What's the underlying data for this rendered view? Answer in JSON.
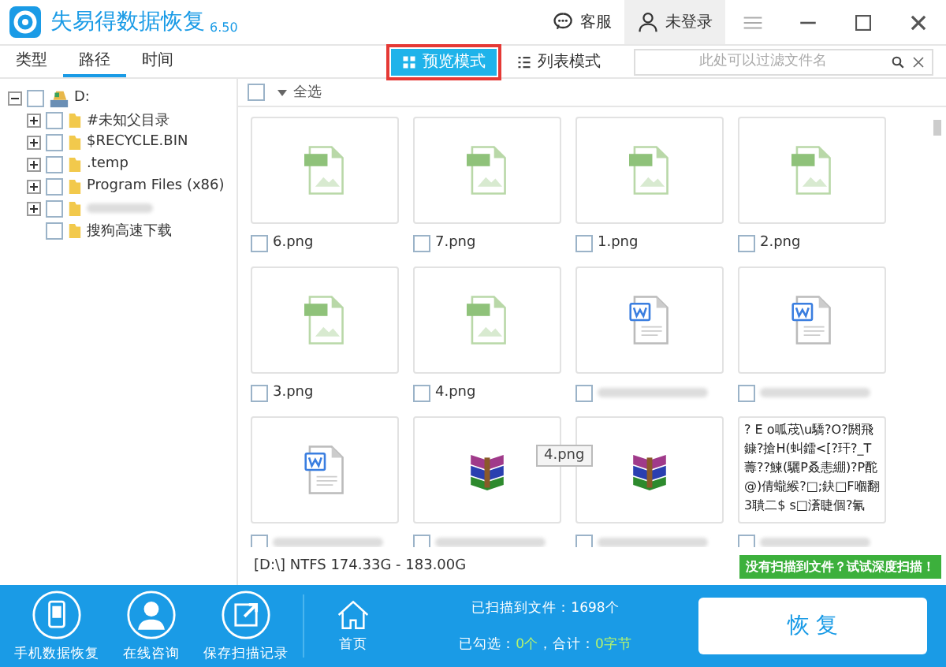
{
  "app": {
    "title": "失易得数据恢复",
    "version": "6.50"
  },
  "header": {
    "service": "客服",
    "user": "未登录"
  },
  "tabs": [
    {
      "label": "类型",
      "selected": false
    },
    {
      "label": "路径",
      "selected": true
    },
    {
      "label": "时间",
      "selected": false
    }
  ],
  "view_modes": [
    {
      "label": "预览模式",
      "kind": "grid",
      "selected": true
    },
    {
      "label": "列表模式",
      "kind": "list",
      "selected": false
    }
  ],
  "search": {
    "placeholder": "此处可以过滤文件名"
  },
  "tree": {
    "label": "D:",
    "checked": false,
    "expanded": true,
    "children": [
      {
        "label": "#未知父目录",
        "checked": false,
        "expandable": true
      },
      {
        "label": "$RECYCLE.BIN",
        "checked": false,
        "expandable": true
      },
      {
        "label": ".temp",
        "checked": false,
        "expandable": true
      },
      {
        "label": "Program Files (x86)",
        "checked": false,
        "expandable": true
      },
      {
        "checked": false,
        "expandable": true
      },
      {
        "label": "搜狗高速下载",
        "checked": false,
        "expandable": false
      }
    ]
  },
  "select_all": {
    "label": "全选",
    "checked": false
  },
  "files": [
    {
      "kind": "png",
      "label": "6.png",
      "checked": false
    },
    {
      "kind": "png",
      "label": "7.png",
      "checked": false
    },
    {
      "kind": "png",
      "label": "1.png",
      "checked": false
    },
    {
      "kind": "png",
      "label": "2.png",
      "checked": false
    },
    {
      "kind": "png",
      "label": "3.png",
      "checked": false
    },
    {
      "kind": "png",
      "label": "4.png",
      "checked": false
    },
    {
      "kind": "doc",
      "checked": false
    },
    {
      "kind": "doc",
      "checked": false
    },
    {
      "kind": "doc",
      "checked": false
    },
    {
      "kind": "rar",
      "checked": false
    },
    {
      "kind": "rar",
      "checked": false
    },
    {
      "kind": "text",
      "checked": false,
      "preview": "? E o呱荗\\u驕?O?閼飛鏮?搶H(虯鐳<[?玕?_T薵??鰊(驪P叒恚綳)?P酡@)倩蠬緱?□;鈌□F嗰翻3聵二$ s□濸睫個?氰"
    }
  ],
  "tooltip": "4.png",
  "status": "[D:\\] NTFS 174.33G - 183.00G",
  "deep_scan": "没有扫描到文件？试试深度扫描！",
  "bottom_actions": [
    {
      "label": "手机数据恢复",
      "kind": "phone"
    },
    {
      "label": "在线咨询",
      "kind": "person"
    },
    {
      "label": "保存扫描记录",
      "kind": "export"
    }
  ],
  "home": "首页",
  "scanned": "已扫描到文件：1698个",
  "selection": [
    {
      "text": "已勾选：",
      "kind": "label"
    },
    {
      "text": "0个",
      "kind": "value"
    },
    {
      "text": "，合计：",
      "kind": "label"
    },
    {
      "text": "0字节",
      "kind": "value"
    }
  ],
  "restore": "恢 复"
}
